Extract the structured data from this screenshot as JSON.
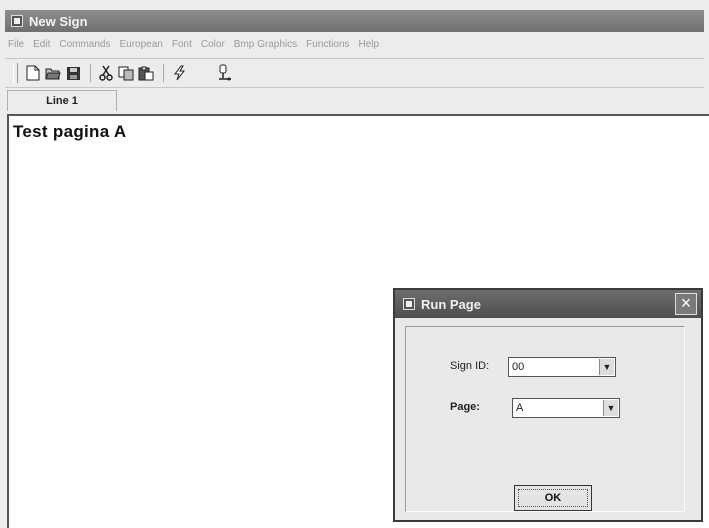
{
  "window": {
    "title": "New Sign"
  },
  "menu": [
    "File",
    "Edit",
    "Commands",
    "European",
    "Font",
    "Color",
    "Bmp Graphics",
    "Functions",
    "Help"
  ],
  "toolbar": {
    "icons": [
      "new-file-icon",
      "open-folder-icon",
      "save-icon",
      "cut-icon",
      "copy-icon",
      "paste-icon",
      "send-icon",
      "connection-icon"
    ]
  },
  "tabs": [
    {
      "label": "Line 1"
    }
  ],
  "editor": {
    "text": "Test pagina A"
  },
  "dialog": {
    "title": "Run Page",
    "sign_id_label": "Sign ID:",
    "sign_id_value": "00",
    "page_label": "Page:",
    "page_value": "A",
    "ok_label": "OK",
    "close_glyph": "×"
  }
}
